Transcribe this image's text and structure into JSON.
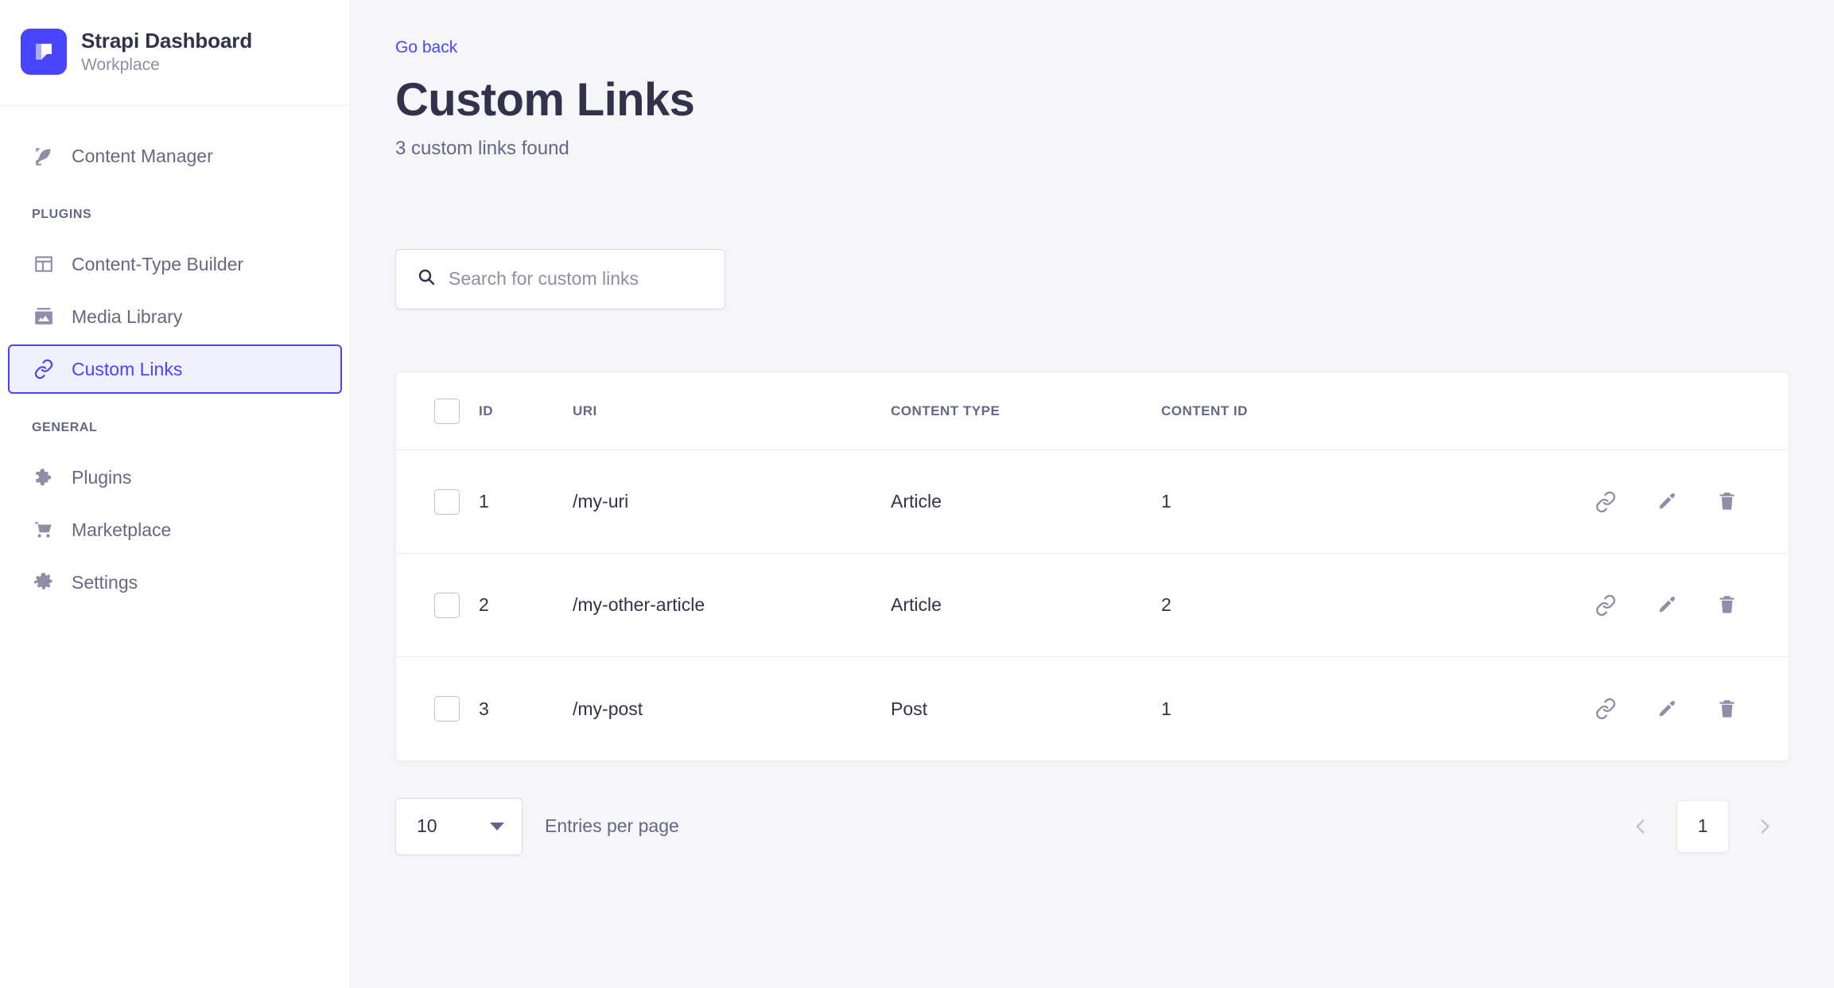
{
  "brand": {
    "logo_icon": "strapi-logo-icon",
    "title": "Strapi Dashboard",
    "subtitle": "Workplace",
    "logo_color": "#4945ff"
  },
  "sidebar": {
    "top_items": [
      {
        "label": "Content Manager",
        "icon": "feather-icon",
        "active": false
      }
    ],
    "sections": [
      {
        "label": "PLUGINS",
        "items": [
          {
            "label": "Content-Type Builder",
            "icon": "layout-icon",
            "active": false
          },
          {
            "label": "Media Library",
            "icon": "image-icon",
            "active": false
          },
          {
            "label": "Custom Links",
            "icon": "link-icon",
            "active": true
          }
        ]
      },
      {
        "label": "GENERAL",
        "items": [
          {
            "label": "Plugins",
            "icon": "puzzle-icon",
            "active": false
          },
          {
            "label": "Marketplace",
            "icon": "shopping-cart-icon",
            "active": false
          },
          {
            "label": "Settings",
            "icon": "gear-icon",
            "active": false
          }
        ]
      }
    ],
    "active_color": "#4945ff",
    "active_bg": "#f0f0ff"
  },
  "header": {
    "go_back": "Go back",
    "title": "Custom Links",
    "subtitle": "3 custom links found"
  },
  "search": {
    "placeholder": "Search for custom links",
    "value": "",
    "icon": "search-icon"
  },
  "table": {
    "columns": [
      "ID",
      "URI",
      "CONTENT TYPE",
      "CONTENT ID"
    ],
    "rows": [
      {
        "id": "1",
        "uri": "/my-uri",
        "content_type": "Article",
        "content_id": "1"
      },
      {
        "id": "2",
        "uri": "/my-other-article",
        "content_type": "Article",
        "content_id": "2"
      },
      {
        "id": "3",
        "uri": "/my-post",
        "content_type": "Post",
        "content_id": "1"
      }
    ],
    "row_actions": [
      "link-icon",
      "pencil-icon",
      "trash-icon"
    ]
  },
  "footer": {
    "entries_per_page_value": "10",
    "entries_per_page_label": "Entries per page",
    "prev_icon": "chevron-left-icon",
    "next_icon": "chevron-right-icon",
    "current_page": "1"
  }
}
